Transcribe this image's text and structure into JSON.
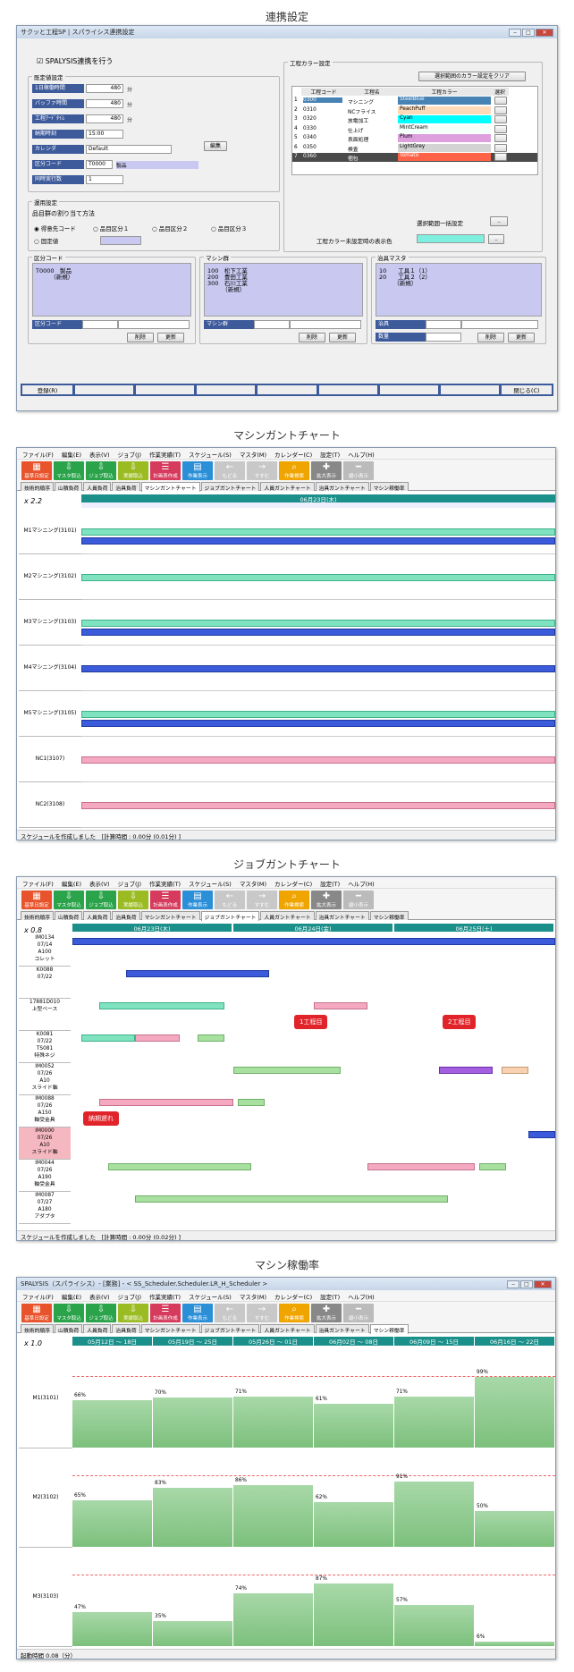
{
  "s1": {
    "heading": "連携設定",
    "title": "サクッと工程SP | スパライシス連携設定",
    "chk": "SPALYSIS連携を行う",
    "basic": "既定値設定",
    "fields": [
      {
        "l": "1日稼働時間",
        "v": "480",
        "u": "分"
      },
      {
        "l": "バッファ時間",
        "v": "480",
        "u": "分"
      },
      {
        "l": "工程ｱｰﾄﾞﾀｲﾑ",
        "v": "480",
        "u": "分"
      },
      {
        "l": "納期時刻",
        "v": "15:00",
        "u": ""
      },
      {
        "l": "カレンダ",
        "v": "Default",
        "u": ""
      },
      {
        "l": "区分コード",
        "v": "T0000",
        "u": "製品"
      },
      {
        "l": "同時実行数",
        "v": "1",
        "u": ""
      }
    ],
    "edit": "編集",
    "color_title": "工程カラー設定",
    "color_clear": "選択範囲のカラー設定をクリア",
    "color_head": [
      "工程コード",
      "工程名",
      "工程カラー",
      "選択"
    ],
    "colors": [
      {
        "n": "1",
        "c": "0300",
        "name": "マシニング",
        "col": "SteelBlue",
        "hex": "#4682b4"
      },
      {
        "n": "2",
        "c": "0310",
        "name": "NCフライス",
        "col": "PeachPuff",
        "hex": "#ffdab9"
      },
      {
        "n": "3",
        "c": "0320",
        "name": "放電加工",
        "col": "Cyan",
        "hex": "#00ffff"
      },
      {
        "n": "4",
        "c": "0330",
        "name": "仕上げ",
        "col": "MintCream",
        "hex": "#f5fffa"
      },
      {
        "n": "5",
        "c": "0340",
        "name": "表面処理",
        "col": "Plum",
        "hex": "#dda0dd"
      },
      {
        "n": "6",
        "c": "0350",
        "name": "検査",
        "col": "LightGrey",
        "hex": "#d3d3d3"
      },
      {
        "n": "7",
        "c": "0360",
        "name": "梱包",
        "col": "Tomato",
        "hex": "#ff6347"
      }
    ],
    "range_set": "選択範囲一括設定",
    "unset_color": "工程カラー未設定時の表示色",
    "ops": "運用設定",
    "assign": "品目群の割り当て方法",
    "radios": [
      "得意先コード",
      "品目区分１",
      "品目区分２",
      "品目区分３",
      "固定値"
    ],
    "cat_title": "区分コード",
    "cat_items": [
      "T0000　製品",
      "　　　（新規）"
    ],
    "mach_title": "マシン群",
    "mach_items": [
      "100　松下工業",
      "200　豊田工業",
      "300　石川工業",
      "　　　（新規）"
    ],
    "jig_title": "治具マスタ",
    "jig_items": [
      "10　　工具１（1）",
      "20　　工具２（2）",
      "　　　（新規）"
    ],
    "cat_lbl": "区分コード",
    "mach_lbl": "マシン群",
    "jig_lbl": "治具",
    "qty_lbl": "数量",
    "del": "削除",
    "upd": "更新",
    "reg": "登録(R)",
    "close": "閉じる(C)"
  },
  "menu": [
    "ファイル(F)",
    "編集(E)",
    "表示(V)",
    "ジョブ(J)",
    "作業実績(T)",
    "スケジュール(S)",
    "マスタ(M)",
    "カレンダー(C)",
    "設定(T)",
    "ヘルプ(H)"
  ],
  "toolbar": [
    {
      "l": "基準日設定",
      "c": "#e8532b",
      "i": "▦"
    },
    {
      "l": "マスタ取込",
      "c": "#2aa34a",
      "i": "⇩"
    },
    {
      "l": "ジョブ取込",
      "c": "#2aa34a",
      "i": "⇩"
    },
    {
      "l": "実績取込",
      "c": "#9bbb22",
      "i": "⇩"
    },
    {
      "l": "計画表作成",
      "c": "#d63a5c",
      "i": "☰"
    },
    {
      "l": "作業表示",
      "c": "#2b8fd8",
      "i": "▤"
    },
    {
      "l": "もどる",
      "c": "#c8c8c8",
      "i": "←"
    },
    {
      "l": "すすむ",
      "c": "#c8c8c8",
      "i": "→"
    },
    {
      "l": "作業検索",
      "c": "#f0a400",
      "i": "⌕"
    },
    {
      "l": "拡大表示",
      "c": "#888",
      "i": "✚"
    },
    {
      "l": "縮小表示",
      "c": "#bbb",
      "i": "━"
    }
  ],
  "tabs": [
    "技術的順序",
    "山積負荷",
    "人員負荷",
    "治具負荷",
    "マシンガントチャート",
    "ジョブガントチャート",
    "人員ガントチャート",
    "治具ガントチャート",
    "マシン稼働率"
  ],
  "s2": {
    "heading": "マシンガントチャート",
    "zoom": "x 2.2",
    "date": "06月23日(木)",
    "rows": [
      "M1マシニング(3101)",
      "M2マシニング(3102)",
      "M3マシニング(3103)",
      "M4マシニング(3104)",
      "M5マシニング(3105)",
      "NC1(3107)",
      "NC2(3108)"
    ],
    "status": "スケジュールを作成しました　[計算時間 : 0.00分 (0.01分) ]"
  },
  "s3": {
    "heading": "ジョブガントチャート",
    "zoom": "x 0.8",
    "dates": [
      "06月23日(木)",
      "06月24日(金)",
      "06月25日(土)"
    ],
    "rows": [
      [
        "IM0134",
        "07/14",
        "A100",
        "コレット"
      ],
      [
        "K0088",
        "07/22",
        "",
        ""
      ],
      [
        "17881D010",
        "上型ベース",
        ""
      ],
      [
        "K0081",
        "07/22",
        "TS081",
        "特殊ネジ"
      ],
      [
        "IM0052",
        "07/26",
        "A10",
        "スライド軸"
      ],
      [
        "IM0088",
        "07/26",
        "A150",
        "軸受金具"
      ],
      [
        "IM0000",
        "07/26",
        "A10",
        "スライド軸"
      ],
      [
        "IM0044",
        "07/26",
        "A190",
        "軸受金具"
      ],
      [
        "IM0087",
        "07/27",
        "A180",
        "アダプタ"
      ]
    ],
    "c1": "1工程目",
    "c2": "2工程目",
    "late": "納期遅れ",
    "status": "スケジュールを作成しました　[計算時間 : 0.00分 (0.02分) ]"
  },
  "s4": {
    "heading": "マシン稼働率",
    "title": "SPALYSIS（スパライシス）- [業務] - < SS_Scheduler.Scheduler.LR_H_Scheduler >",
    "zoom": "x 1.0",
    "weeks": [
      "05月12日 ～ 18日",
      "05月19日 ～ 25日",
      "05月26日 ～ 01日",
      "06月02日 ～ 08日",
      "06月09日 ～ 15日",
      "06月16日 ～ 22日"
    ],
    "rows": [
      {
        "n": "M1(3101)",
        "v": [
          66,
          70,
          71,
          61,
          71,
          99
        ]
      },
      {
        "n": "M2(3102)",
        "v": [
          65,
          83,
          86,
          62,
          91,
          50
        ]
      },
      {
        "n": "M3(3103)",
        "v": [
          47,
          35,
          74,
          87,
          57,
          6
        ]
      }
    ],
    "status": "起動時間 0.08（分）"
  }
}
